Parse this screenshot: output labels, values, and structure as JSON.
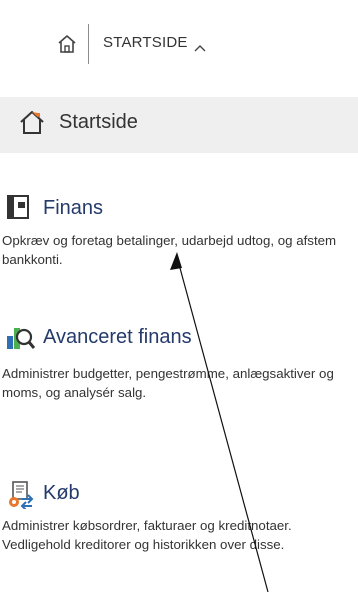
{
  "topbar": {
    "home_icon": "home-icon",
    "breadcrumb": "STARTSIDE",
    "chevron_icon": "chevron-up-icon"
  },
  "active": {
    "icon": "house-icon",
    "label": "Startside"
  },
  "sections": [
    {
      "icon": "finance-ledger-icon",
      "title": "Finans",
      "description": "Opkræv og foretag betalinger, udarbejd udtog, og afstem bankkonti."
    },
    {
      "icon": "chart-analysis-icon",
      "title": "Avanceret finans",
      "description": "Administrer budgetter, pengestrømme, anlægsaktiver og moms, og analysér salg."
    },
    {
      "icon": "purchase-icon",
      "title": "Køb",
      "description": "Administrer købsordrer, fakturaer og kreditnotaer. Vedligehold kreditorer og historikken over disse."
    }
  ],
  "colors": {
    "accent": "#243a6b",
    "active_background": "#efefef",
    "house_roof": "#e8762c",
    "house_outline": "#333333"
  },
  "annotation": "arrow-pointer-overlay"
}
